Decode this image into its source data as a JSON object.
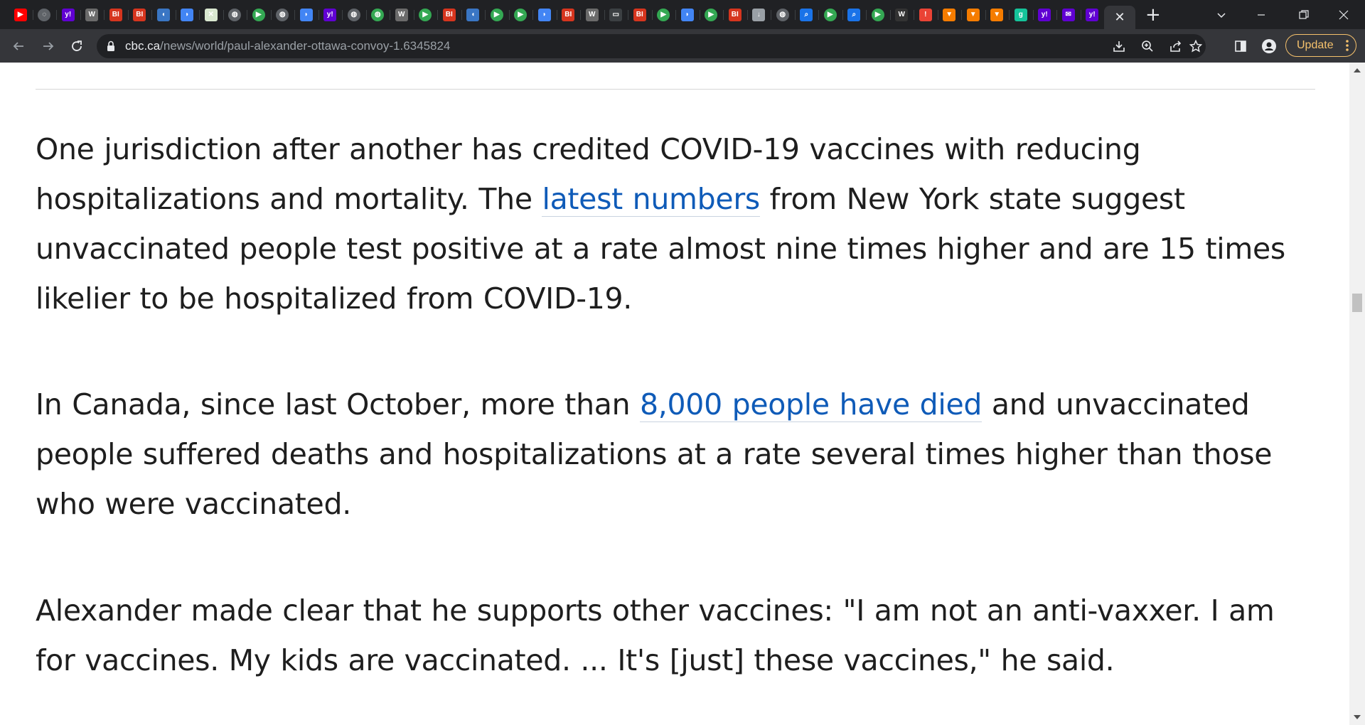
{
  "browser": {
    "tabs": [
      {
        "icon": "youtube-icon",
        "glyph": "▶",
        "color": "#ff0000",
        "circle": false
      },
      {
        "icon": "shield-globe-icon",
        "glyph": "◌",
        "color": "#5f6368",
        "circle": true
      },
      {
        "icon": "yahoo-icon",
        "glyph": "y!",
        "color": "#6001d2",
        "circle": false
      },
      {
        "icon": "wsj-icon",
        "glyph": "W",
        "color": "#6b6b6b",
        "circle": false
      },
      {
        "icon": "business-insider-icon",
        "glyph": "BI",
        "color": "#d6351e",
        "circle": false
      },
      {
        "icon": "business-insider-icon",
        "glyph": "BI",
        "color": "#d6351e",
        "circle": false
      },
      {
        "icon": "shield-icon",
        "glyph": "◖",
        "color": "#3a76c4",
        "circle": false
      },
      {
        "icon": "flag-icon",
        "glyph": "◗",
        "color": "#4285f4",
        "circle": false
      },
      {
        "icon": "map-icon",
        "glyph": "✕",
        "color": "#d9e8d0",
        "circle": false
      },
      {
        "icon": "globe-icon",
        "glyph": "◍",
        "color": "#5f6368",
        "circle": true
      },
      {
        "icon": "play-icon",
        "glyph": "▶",
        "color": "#34a853",
        "circle": true
      },
      {
        "icon": "globe-icon",
        "glyph": "◍",
        "color": "#5f6368",
        "circle": true
      },
      {
        "icon": "flag-icon",
        "glyph": "◗",
        "color": "#4285f4",
        "circle": false
      },
      {
        "icon": "yahoo-icon",
        "glyph": "y!",
        "color": "#6001d2",
        "circle": false
      },
      {
        "icon": "globe-icon",
        "glyph": "◍",
        "color": "#5f6368",
        "circle": true
      },
      {
        "icon": "globe-icon",
        "glyph": "◍",
        "color": "#34a853",
        "circle": true
      },
      {
        "icon": "wsj-icon",
        "glyph": "W",
        "color": "#6b6b6b",
        "circle": false
      },
      {
        "icon": "play-icon",
        "glyph": "▶",
        "color": "#34a853",
        "circle": true
      },
      {
        "icon": "business-insider-icon",
        "glyph": "BI",
        "color": "#d6351e",
        "circle": false
      },
      {
        "icon": "shield-icon",
        "glyph": "◖",
        "color": "#3a76c4",
        "circle": false
      },
      {
        "icon": "play-icon",
        "glyph": "▶",
        "color": "#34a853",
        "circle": true
      },
      {
        "icon": "play-icon",
        "glyph": "▶",
        "color": "#34a853",
        "circle": true
      },
      {
        "icon": "flag-icon",
        "glyph": "◗",
        "color": "#4285f4",
        "circle": false
      },
      {
        "icon": "business-insider-icon",
        "glyph": "BI",
        "color": "#d6351e",
        "circle": false
      },
      {
        "icon": "wsj-icon",
        "glyph": "W",
        "color": "#6b6b6b",
        "circle": false
      },
      {
        "icon": "document-icon",
        "glyph": "▭",
        "color": "#3c4043",
        "circle": false
      },
      {
        "icon": "business-insider-icon",
        "glyph": "BI",
        "color": "#d6351e",
        "circle": false
      },
      {
        "icon": "play-icon",
        "glyph": "▶",
        "color": "#34a853",
        "circle": true
      },
      {
        "icon": "flag-icon",
        "glyph": "◗",
        "color": "#4285f4",
        "circle": false
      },
      {
        "icon": "play-icon",
        "glyph": "▶",
        "color": "#34a853",
        "circle": true
      },
      {
        "icon": "business-insider-icon",
        "glyph": "BI",
        "color": "#d6351e",
        "circle": false
      },
      {
        "icon": "download-icon",
        "glyph": "↓",
        "color": "#9aa0a6",
        "circle": false
      },
      {
        "icon": "globe-icon",
        "glyph": "◍",
        "color": "#5f6368",
        "circle": true
      },
      {
        "icon": "search-icon",
        "glyph": "⌕",
        "color": "#1a73e8",
        "circle": false
      },
      {
        "icon": "play-icon",
        "glyph": "▶",
        "color": "#34a853",
        "circle": true
      },
      {
        "icon": "search-icon",
        "glyph": "⌕",
        "color": "#1a73e8",
        "circle": false
      },
      {
        "icon": "play-icon",
        "glyph": "▶",
        "color": "#34a853",
        "circle": true
      },
      {
        "icon": "wsj-icon",
        "glyph": "W",
        "color": "#333333",
        "circle": false
      },
      {
        "icon": "alert-icon",
        "glyph": "!",
        "color": "#ea4335",
        "circle": false
      },
      {
        "icon": "bookmark-icon",
        "glyph": "▼",
        "color": "#f57c00",
        "circle": false
      },
      {
        "icon": "bookmark-icon",
        "glyph": "▼",
        "color": "#f57c00",
        "circle": false
      },
      {
        "icon": "bookmark-icon",
        "glyph": "▼",
        "color": "#f57c00",
        "circle": false
      },
      {
        "icon": "grammarly-icon",
        "glyph": "g",
        "color": "#15c39a",
        "circle": false
      },
      {
        "icon": "yahoo-icon",
        "glyph": "y!",
        "color": "#6001d2",
        "circle": false
      },
      {
        "icon": "yahoo-mail-icon",
        "glyph": "✉",
        "color": "#6001d2",
        "circle": false
      },
      {
        "icon": "yahoo-icon",
        "glyph": "y!",
        "color": "#6001d2",
        "circle": false
      }
    ],
    "address": {
      "domain": "cbc.ca",
      "path": "/news/world/paul-alexander-ottawa-convoy-1.6345824"
    },
    "update_label": "Update"
  },
  "article": {
    "paragraphs": [
      {
        "before": "One jurisdiction after another has credited COVID-19 vaccines with reducing hospitalizations and mortality. The ",
        "link": "latest numbers",
        "after": " from New York state suggest unvaccinated people test positive at a rate almost nine times higher and are 15 times likelier to be hospitalized from COVID-19."
      },
      {
        "before": "In Canada, since last October, more than ",
        "link": "8,000 people have died",
        "after": " and unvaccinated people suffered deaths and hospitalizations at a rate several times higher than those who were vaccinated."
      },
      {
        "text": "Alexander made clear that he supports other vaccines: \"I am not an anti-vaxxer. I am for vaccines. My kids are vaccinated. ... It's [just] these vaccines,\" he said."
      }
    ]
  }
}
